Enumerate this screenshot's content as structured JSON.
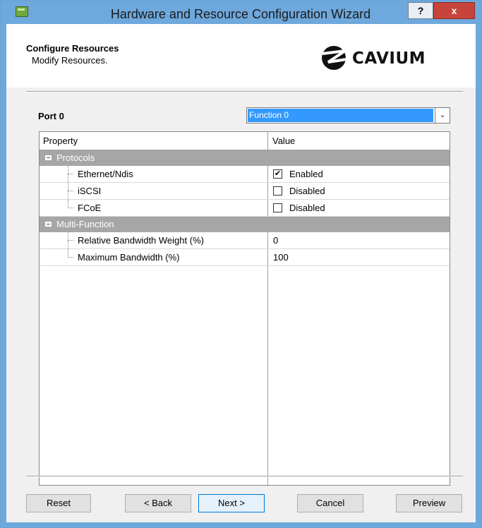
{
  "window": {
    "title": "Hardware and Resource Configuration Wizard",
    "help_glyph": "?",
    "close_glyph": "x"
  },
  "header": {
    "title": "Configure Resources",
    "subtitle": "Modify Resources.",
    "logo_text": "CAVIUM"
  },
  "port": {
    "label": "Port 0",
    "function_selected": "Function 0",
    "dropdown_glyph": "⌄"
  },
  "grid": {
    "columns": [
      "Property",
      "Value"
    ],
    "categories": [
      {
        "name": "Protocols",
        "rows": [
          {
            "property": "Ethernet/Ndis",
            "checked": true,
            "value": "Enabled"
          },
          {
            "property": "iSCSI",
            "checked": false,
            "value": "Disabled"
          },
          {
            "property": "FCoE",
            "checked": false,
            "value": "Disabled"
          }
        ]
      },
      {
        "name": "Multi-Function",
        "rows": [
          {
            "property": "Relative Bandwidth Weight (%)",
            "value": "0"
          },
          {
            "property": "Maximum Bandwidth (%)",
            "value": "100"
          }
        ]
      }
    ],
    "check_glyph": "✔"
  },
  "buttons": {
    "reset": "Reset",
    "back": "< Back",
    "next": "Next >",
    "cancel": "Cancel",
    "preview": "Preview"
  },
  "colors": {
    "titlebar": "#6ea8dc",
    "selection": "#3399ff",
    "category_band": "#a6a6a6",
    "close_button": "#c7443a"
  }
}
